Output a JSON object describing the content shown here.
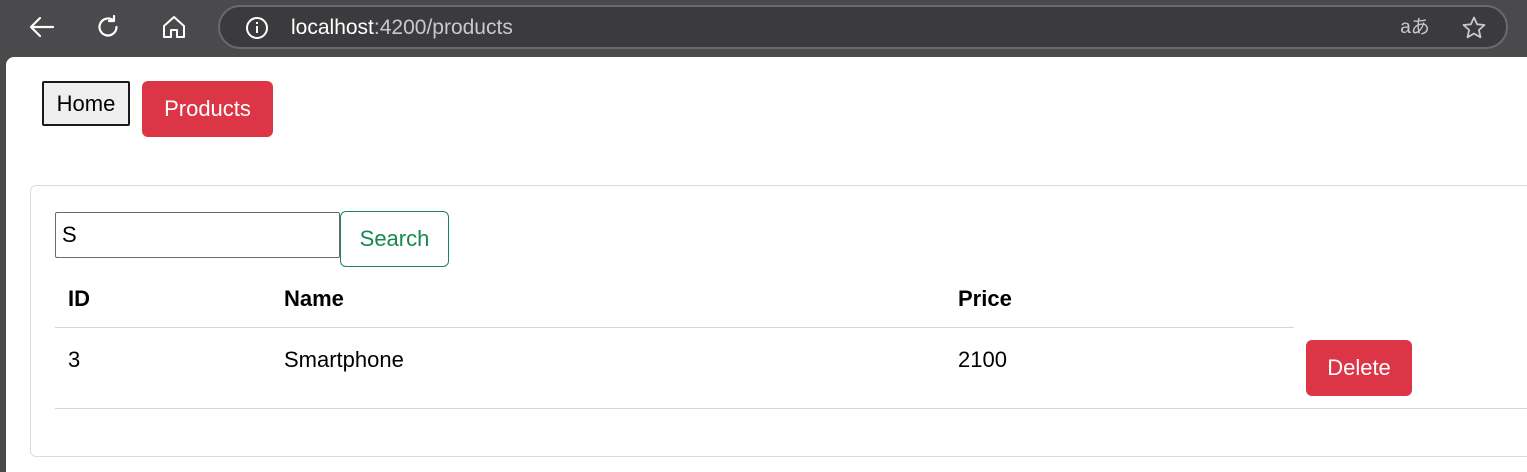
{
  "browser": {
    "url_host": "localhost",
    "url_path": ":4200/products",
    "translate_glyph": "aあ",
    "icons": {
      "back": "back-arrow-icon",
      "reload": "reload-icon",
      "home": "home-icon",
      "info": "info-icon",
      "translate": "translate-icon",
      "favorite": "star-icon"
    }
  },
  "nav": {
    "home_label": "Home",
    "products_label": "Products"
  },
  "search": {
    "value": "S",
    "button_label": "Search"
  },
  "table": {
    "headers": {
      "id": "ID",
      "name": "Name",
      "price": "Price"
    },
    "rows": [
      {
        "id": "3",
        "name": "Smartphone",
        "price": "2100",
        "action_label": "Delete"
      }
    ]
  },
  "colors": {
    "danger": "#dc3545",
    "success": "#198754",
    "chrome": "#4a4a4d"
  }
}
